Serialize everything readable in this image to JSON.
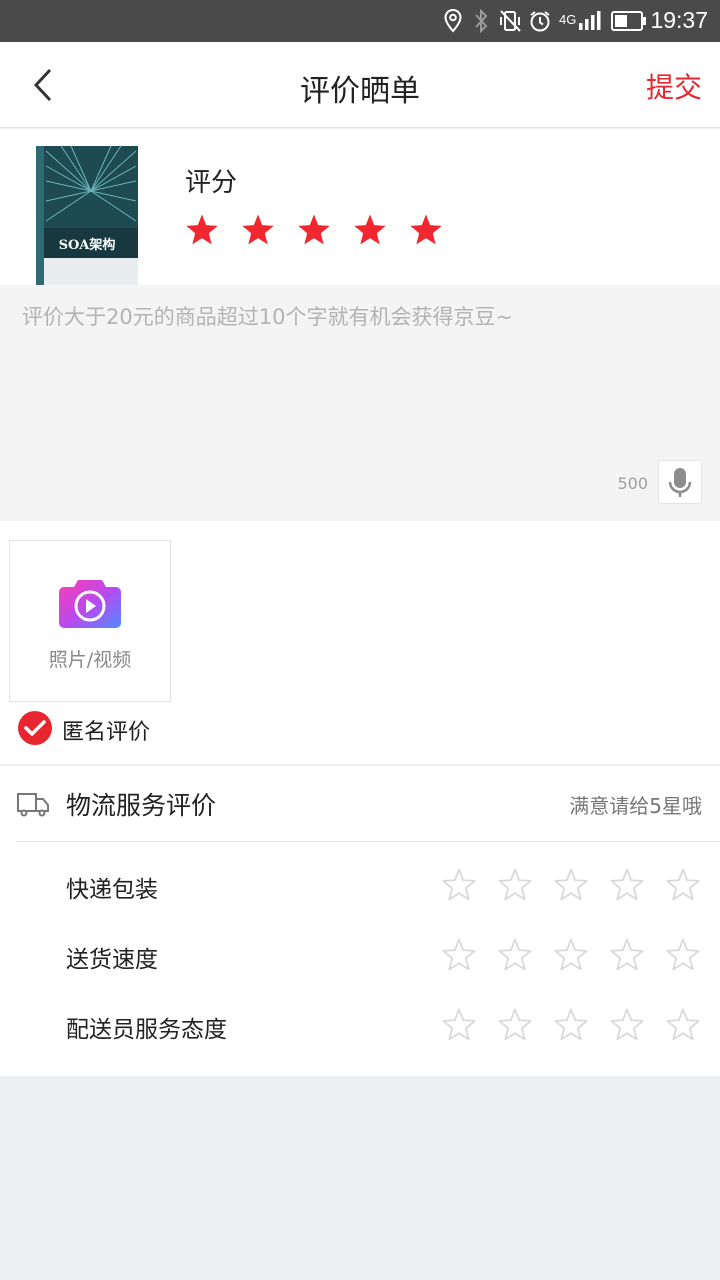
{
  "status_bar": {
    "time": "19:37",
    "network": "4G",
    "icons": [
      "location-icon",
      "bluetooth-icon",
      "vibrate-icon",
      "alarm-icon",
      "signal-icon",
      "battery-icon"
    ]
  },
  "nav": {
    "title": "评价晒单",
    "submit_label": "提交",
    "back_icon": "chevron-left-icon"
  },
  "product": {
    "cover_title": "SOA架构",
    "rating_label": "评分",
    "rating": 5,
    "rating_max": 5,
    "star_color": "#f0272e"
  },
  "review": {
    "placeholder": "评价大于20元的商品超过10个字就有机会获得京豆~",
    "char_limit": "500",
    "mic_icon": "microphone-icon"
  },
  "media": {
    "upload_label": "照片/视频",
    "camera_icon": "camera-icon"
  },
  "anonymous": {
    "label": "匿名评价",
    "checked": true,
    "color": "#e8262f"
  },
  "logistics": {
    "title": "物流服务评价",
    "hint": "满意请给5星哦",
    "truck_icon": "truck-icon",
    "rows": [
      {
        "label": "快递包装",
        "rating": 0
      },
      {
        "label": "送货速度",
        "rating": 0
      },
      {
        "label": "配送员服务态度",
        "rating": 0
      }
    ]
  },
  "colors": {
    "accent": "#e8262f",
    "status_bar": "#4a4a4a",
    "empty_star": "#d9d9d9"
  }
}
